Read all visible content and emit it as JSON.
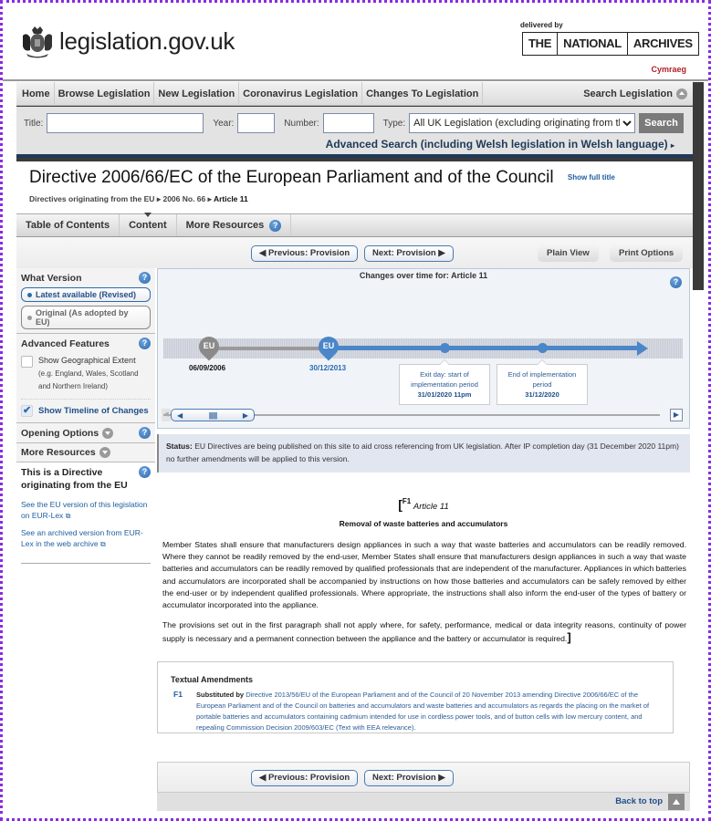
{
  "header": {
    "site_name": "legislation.gov.uk",
    "delivered_by": "delivered by",
    "tna": [
      "THE",
      "NATIONAL",
      "ARCHIVES"
    ],
    "language_link": "Cymraeg"
  },
  "nav": {
    "items": [
      "Home",
      "Browse Legislation",
      "New Legislation",
      "Coronavirus Legislation",
      "Changes To Legislation"
    ],
    "search_toggle": "Search Legislation"
  },
  "search": {
    "title_label": "Title:",
    "title_value": "",
    "year_label": "Year:",
    "year_value": "",
    "number_label": "Number:",
    "number_value": "",
    "type_label": "Type:",
    "type_selected": "All UK Legislation (excluding originating from the EU)",
    "search_button": "Search",
    "advanced_link": "Advanced Search (including Welsh legislation in Welsh language)"
  },
  "document": {
    "title": "Directive 2006/66/EC of the European Parliament and of the Council",
    "show_full_title": "Show full title",
    "breadcrumb": [
      "Directives originating from the EU",
      "2006 No. 66",
      "Article 11"
    ]
  },
  "tabs": {
    "items": [
      "Table of Contents",
      "Content",
      "More Resources"
    ],
    "active": "Content"
  },
  "toolbar": {
    "previous": "Previous: Provision",
    "next": "Next: Provision",
    "plain_view": "Plain View",
    "print_options": "Print Options"
  },
  "sidebar": {
    "what_version": "What Version",
    "latest": "Latest available (Revised)",
    "original": "Original (As adopted by EU)",
    "advanced_features": "Advanced Features",
    "geo_extent_label": "Show Geographical Extent",
    "geo_extent_checked": false,
    "geo_extent_note": "(e.g. England, Wales, Scotland and Northern Ireland)",
    "timeline_label": "Show Timeline of Changes",
    "timeline_checked": true,
    "opening_options": "Opening Options",
    "more_resources": "More Resources",
    "eu_note_title": "This is a Directive originating from the EU",
    "eu_links": [
      "See the EU version of this legislation on EUR-Lex",
      "See an archived version from EUR-Lex in the web archive"
    ]
  },
  "timeline": {
    "title": "Changes over time for: Article 11",
    "points": [
      {
        "marker": "EU",
        "date": "06/09/2006",
        "state": "original"
      },
      {
        "marker": "EU",
        "date": "30/12/2013",
        "state": "current"
      }
    ],
    "events": [
      {
        "label": "Exit day: start of implementation period",
        "date": "31/01/2020 11pm"
      },
      {
        "label": "End of implementation period",
        "date": "31/12/2020"
      }
    ],
    "colors": {
      "original": "#8a8a8a",
      "current": "#4a86c8"
    }
  },
  "status": {
    "label": "Status:",
    "text": "EU Directives are being published on this site to aid cross referencing from UK legislation. After IP completion day (31 December 2020 11pm) no further amendments will be applied to this version."
  },
  "article": {
    "amendment_ref": "F1",
    "number": "Article 11",
    "title": "Removal of waste batteries and accumulators",
    "paragraphs": [
      "Member States shall ensure that manufacturers design appliances in such a way that waste batteries and accumulators can be readily removed. Where they cannot be readily removed by the end-user, Member States shall ensure that manufacturers design appliances in such a way that waste batteries and accumulators can be readily removed by qualified professionals that are independent of the manufacturer. Appliances in which batteries and accumulators are incorporated shall be accompanied by instructions on how those batteries and accumulators can be safely removed by either the end-user or by independent qualified professionals. Where appropriate, the instructions shall also inform the end-user of the types of battery or accumulator incorporated into the appliance.",
      "The provisions set out in the first paragraph shall not apply where, for safety, performance, medical or data integrity reasons, continuity of power supply is necessary and a permanent connection between the appliance and the battery or accumulator is required."
    ]
  },
  "amendments": {
    "heading": "Textual Amendments",
    "items": [
      {
        "key": "F1",
        "prefix": "Substituted by",
        "text": "Directive 2013/56/EU of the European Parliament and of the Council of 20 November 2013 amending Directive 2006/66/EC of the European Parliament and of the Council on batteries and accumulators and waste batteries and accumulators as regards the placing on the market of portable batteries and accumulators containing cadmium intended for use in cordless power tools, and of button cells with low mercury content, and repealing Commission Decision 2009/603/EC (Text with EEA relevance)."
      }
    ]
  },
  "footer": {
    "back_to_top": "Back to top"
  }
}
